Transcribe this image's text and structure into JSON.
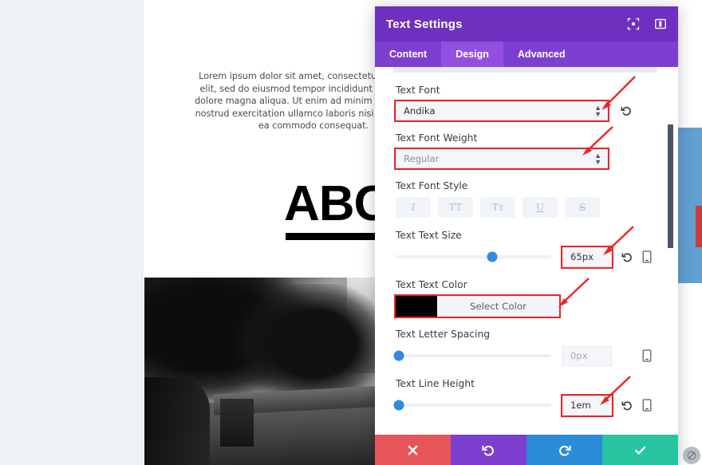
{
  "panel": {
    "title": "Text Settings",
    "header_icons": [
      {
        "name": "expand-icon"
      },
      {
        "name": "layout-toggle-icon"
      }
    ],
    "tabs": [
      {
        "label": "Content",
        "active": false
      },
      {
        "label": "Design",
        "active": true
      },
      {
        "label": "Advanced",
        "active": false
      }
    ],
    "fields": {
      "font": {
        "label": "Text Font",
        "value": "Andika",
        "highlighted": true
      },
      "font_weight": {
        "label": "Text Font Weight",
        "value": "Regular",
        "highlighted": true
      },
      "font_style": {
        "label": "Text Font Style",
        "buttons": [
          {
            "name": "italic-button",
            "glyph": "I"
          },
          {
            "name": "uppercase-button",
            "glyph": "TT"
          },
          {
            "name": "small-caps-button",
            "glyph": "Tᴛ"
          },
          {
            "name": "underline-button",
            "glyph": "U"
          },
          {
            "name": "strikethrough-button",
            "glyph": "S"
          }
        ]
      },
      "text_size": {
        "label": "Text Text Size",
        "value": "65px",
        "slider_percent": 62,
        "highlighted": true
      },
      "text_color": {
        "label": "Text Text Color",
        "swatch": "#000000",
        "button_label": "Select Color",
        "highlighted": true
      },
      "letter_spacing": {
        "label": "Text Letter Spacing",
        "value": "0px",
        "slider_percent": 2,
        "highlighted": false
      },
      "line_height": {
        "label": "Text Line Height",
        "value": "1em",
        "slider_percent": 2,
        "highlighted": true
      }
    },
    "footer_buttons": [
      {
        "name": "cancel-button",
        "icon": "close-icon",
        "color": "#e8565a"
      },
      {
        "name": "undo-button",
        "icon": "undo-icon",
        "color": "#7c3fd0"
      },
      {
        "name": "redo-button",
        "icon": "redo-icon",
        "color": "#2a8bd6"
      },
      {
        "name": "save-button",
        "icon": "check-icon",
        "color": "#27c4a0"
      }
    ]
  },
  "page": {
    "paragraph": "Lorem ipsum dolor sit amet, consectetur adipiscing elit, sed do eiusmod tempor incididunt ut labore et dolore magna aliqua. Ut enim ad minim veniam, quis nostrud exercitation ullamco laboris nisi ut aliquip ex ea commodo consequat.",
    "heading": "ABOUT"
  },
  "colors": {
    "panel_header": "#6f2fbf",
    "tab_bar": "#7c3fd0",
    "tab_active": "#9350e0",
    "accent_blue": "#2f8ae0",
    "shape_blue": "#62a0d0",
    "highlight_red": "#ee2424",
    "background": "#eff3f8"
  }
}
